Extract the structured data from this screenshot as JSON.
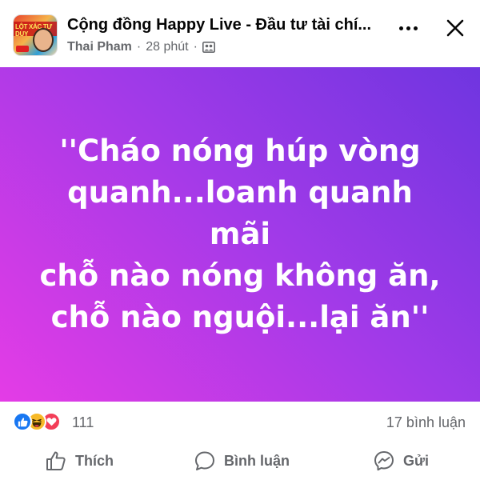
{
  "header": {
    "group_name": "Cộng đồng Happy Live - Đầu tư tài chí...",
    "author": "Thai Pham",
    "separator": "·",
    "time": "28 phút",
    "avatar_text": "LỘT XÁC TƯ DUY"
  },
  "post": {
    "text_lines": [
      "''Cháo nóng húp vòng",
      "quanh...loanh quanh mãi",
      "chỗ nào nóng không ăn,",
      "chỗ nào nguội...lại ăn''"
    ],
    "background_colors": [
      "#6f35e0",
      "#e43ce6"
    ]
  },
  "reactions": {
    "types": [
      "like",
      "haha",
      "love"
    ],
    "count": "111",
    "comments": "17 bình luận"
  },
  "actions": {
    "like_label": "Thích",
    "comment_label": "Bình luận",
    "share_label": "Gửi"
  },
  "colors": {
    "like_blue": "#1877f2",
    "haha_yellow": "#f7b928",
    "love_red": "#f33e58",
    "secondary_text": "#65676b"
  }
}
